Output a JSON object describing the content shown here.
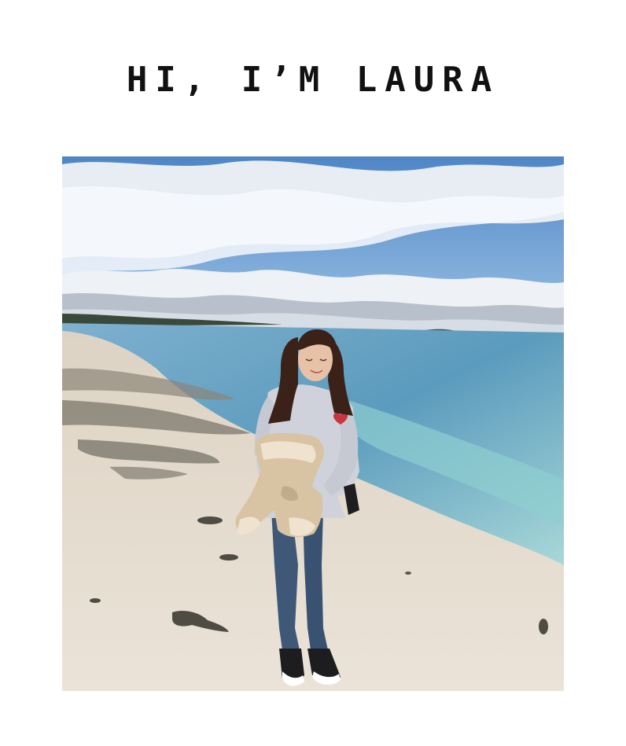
{
  "headline": "HI, I’M LAURA",
  "photo": {
    "kind": "beach-portrait",
    "colors": {
      "sky_top": "#4f86c6",
      "sky_bottom": "#9cc2e6",
      "cloud": "#f2f4f7",
      "cloud_shadow": "#a9b3bf",
      "sea_deep": "#5b9bbd",
      "sea_shallow": "#a8d8d8",
      "sand": "#e6ddd0",
      "rock": "#6f6b60",
      "hoodie": "#cfd2da",
      "jacket": "#d8c3a2",
      "jeans": "#3f5878",
      "hair": "#3a2218"
    }
  }
}
